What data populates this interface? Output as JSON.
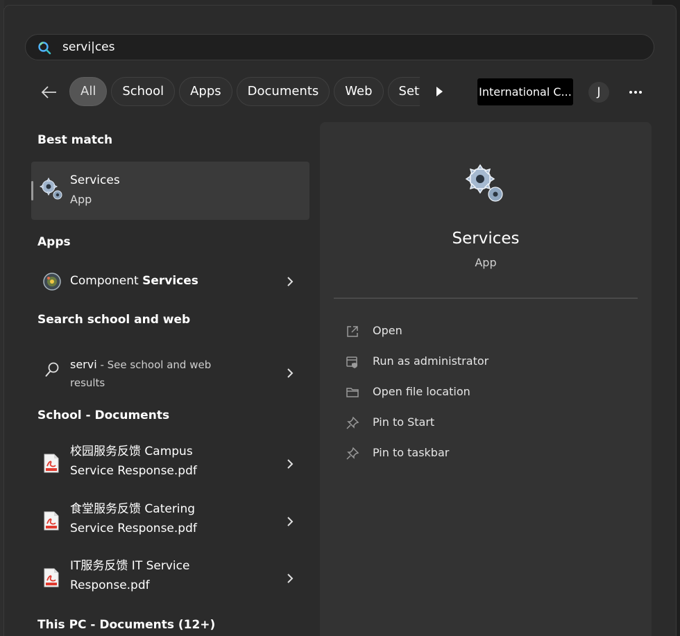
{
  "search": {
    "value": "servi|ces"
  },
  "filters": {
    "chips": [
      "All",
      "School",
      "Apps",
      "Documents",
      "Web",
      "Setti"
    ],
    "active": "All"
  },
  "header": {
    "org_badge": "International C...",
    "avatar_initial": "J"
  },
  "best_match": {
    "heading": "Best match",
    "title": "Services",
    "subtitle": "App"
  },
  "apps": {
    "heading": "Apps",
    "item_prefix": "Component ",
    "item_bold": "Services"
  },
  "web": {
    "heading": "Search school and web",
    "query": "servi",
    "suffix": " - See school and web",
    "suffix2": "results"
  },
  "school_docs": {
    "heading": "School - Documents",
    "items": [
      {
        "line1": "校园服务反馈 Campus",
        "line2": "Service Response.pdf"
      },
      {
        "line1": "食堂服务反馈 Catering",
        "line2": "Service Response.pdf"
      },
      {
        "line1": "IT服务反馈 IT Service",
        "line2": "Response.pdf"
      }
    ]
  },
  "this_pc": {
    "heading": "This PC - Documents (12+)"
  },
  "detail": {
    "title": "Services",
    "subtitle": "App",
    "actions": [
      {
        "label": "Open",
        "icon": "open-external-icon"
      },
      {
        "label": "Run as administrator",
        "icon": "shield-admin-icon"
      },
      {
        "label": "Open file location",
        "icon": "folder-icon"
      },
      {
        "label": "Pin to Start",
        "icon": "pin-icon"
      },
      {
        "label": "Pin to taskbar",
        "icon": "pin-icon"
      }
    ]
  },
  "colors": {
    "panel": "#2b2b2b",
    "detail_pane": "#333333",
    "active_chip": "#555555",
    "badge": "#000000"
  }
}
